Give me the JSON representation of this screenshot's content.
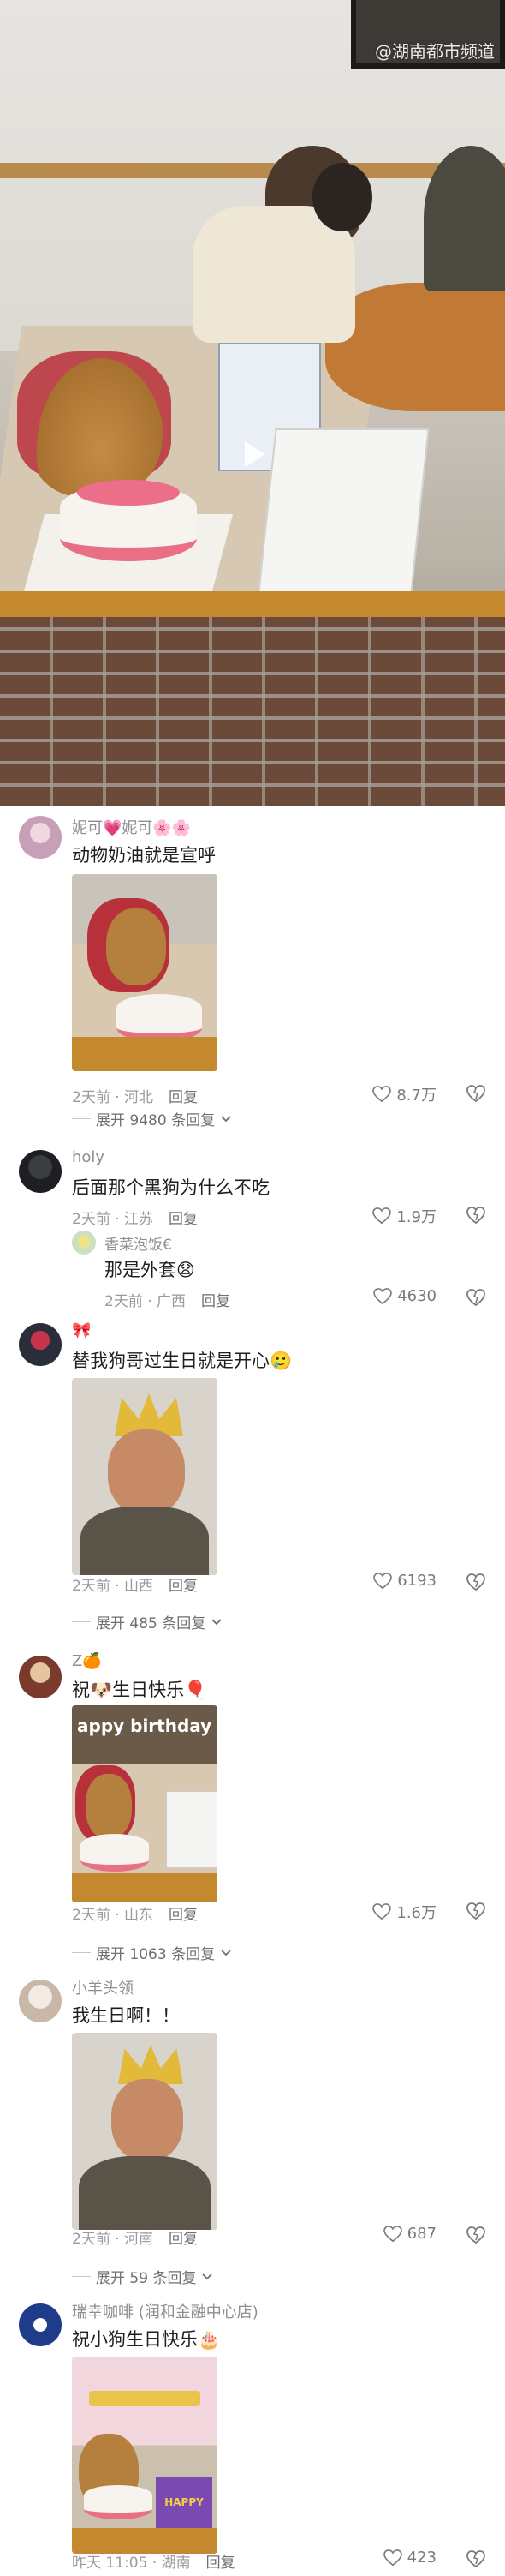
{
  "video": {
    "watermark": "@湖南都市频道",
    "play_icon": "play-icon"
  },
  "comments": [
    {
      "username": "妮可💗妮可🌸🌸",
      "text": "动物奶油就是宣呼",
      "time": "2天前",
      "location": "河北",
      "reply_label": "回复",
      "likes": "8.7万",
      "expand_label": "展开 9480 条回复"
    },
    {
      "username": "holy",
      "text": "后面那个黑狗为什么不吃",
      "time": "2天前",
      "location": "江苏",
      "reply_label": "回复",
      "likes": "1.9万",
      "reply": {
        "username": "香菜泡饭€",
        "text": "那是外套😧",
        "time": "2天前",
        "location": "广西",
        "reply_label": "回复",
        "likes": "4630"
      }
    },
    {
      "username": "🎀",
      "text": "替我狗哥过生日就是开心🥲",
      "time": "2天前",
      "location": "山西",
      "reply_label": "回复",
      "likes": "6193",
      "expand_label": "展开 485 条回复"
    },
    {
      "username": "Z🍊",
      "text": "祝🐶生日快乐🎈",
      "time": "2天前",
      "location": "山东",
      "reply_label": "回复",
      "likes": "1.6万",
      "expand_label": "展开 1063 条回复",
      "thumb_text": "appy birthday"
    },
    {
      "username": "小羊头领",
      "text": "我生日啊！！",
      "time": "2天前",
      "location": "河南",
      "reply_label": "回复",
      "likes": "687",
      "expand_label": "展开 59 条回复"
    },
    {
      "username": "瑞幸咖啡 (润和金融中心店)",
      "text": "祝小狗生日快乐🎂",
      "time": "昨天 11:05",
      "location": "湖南",
      "reply_label": "回复",
      "likes": "423",
      "thumb_text": "HAPPY"
    }
  ],
  "colors": {
    "text_primary": "#1f1f1f",
    "text_secondary": "#9a9a9f",
    "cake_pink": "#ec6f8a",
    "crown_gold": "#e3b93a"
  }
}
